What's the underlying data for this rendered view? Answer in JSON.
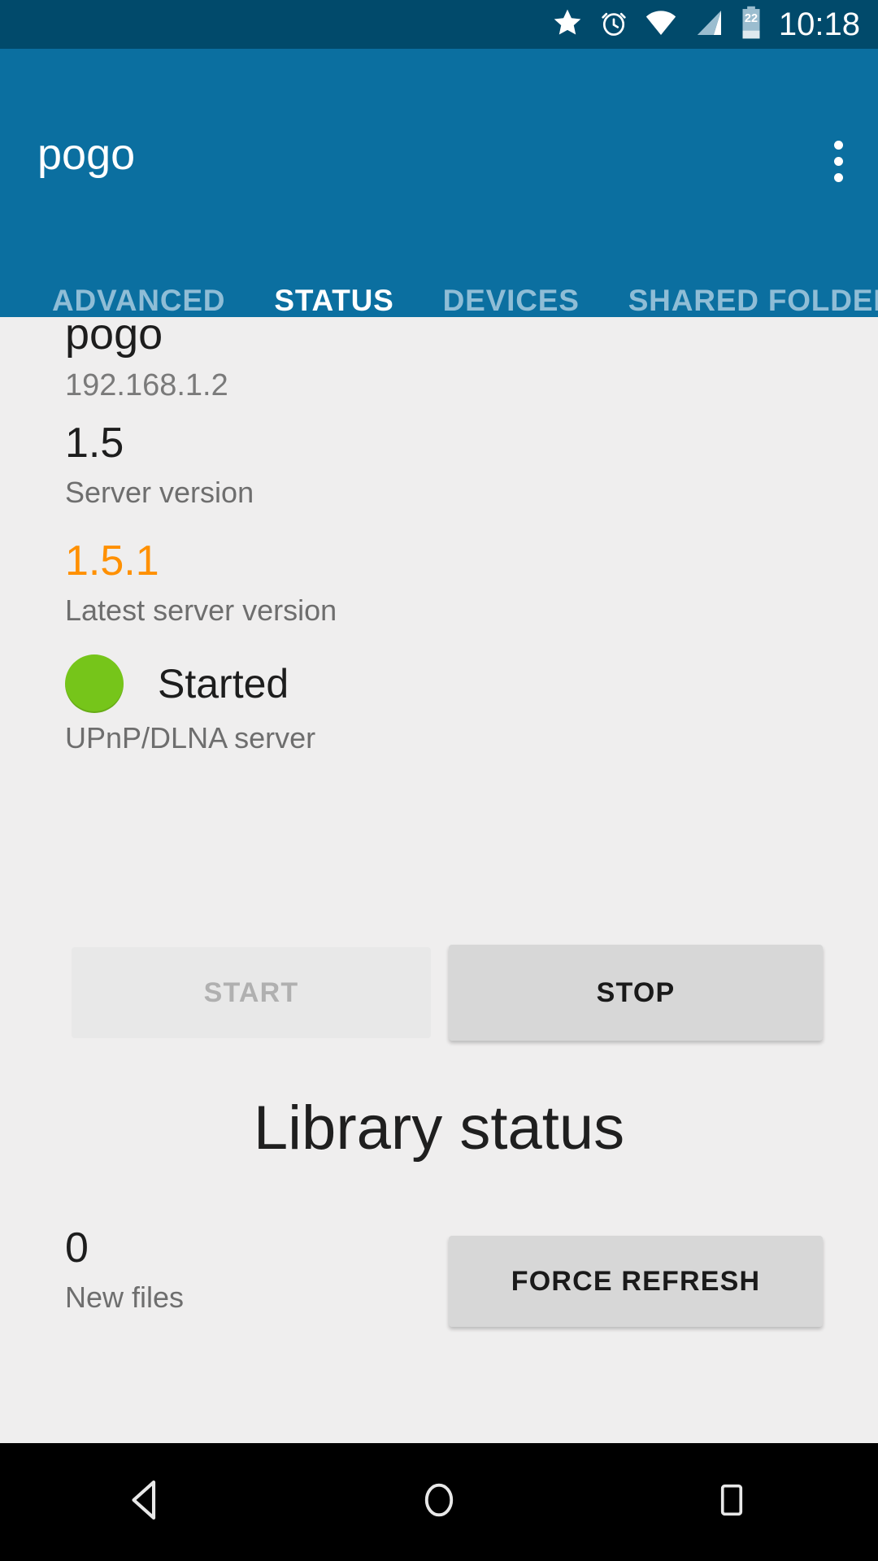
{
  "statusbar": {
    "time": "10:18",
    "battery_level": "22",
    "icons": [
      "star-icon",
      "alarm-icon",
      "wifi-icon",
      "signal-icon",
      "battery-icon"
    ]
  },
  "appbar": {
    "title": "pogo",
    "overflow_icon": "overflow-menu-icon",
    "accent_color": "#0B6FA0",
    "indicator_color": "#FBB63C"
  },
  "tabs": [
    {
      "label": "ADVANCED",
      "active": false
    },
    {
      "label": "STATUS",
      "active": true
    },
    {
      "label": "DEVICES",
      "active": false
    },
    {
      "label": "SHARED FOLDERS",
      "active": false
    }
  ],
  "status_page": {
    "host": {
      "name": "pogo",
      "address": "192.168.1.2"
    },
    "server_version": {
      "value": "1.5",
      "label": "Server version"
    },
    "latest_server_version": {
      "value": "1.5.1",
      "label": "Latest server version",
      "color": "#FF9000"
    },
    "server_state": {
      "value": "Started",
      "label": "UPnP/DLNA server",
      "dot_color": "#76C51A"
    },
    "start_button": "START",
    "stop_button": "STOP",
    "library": {
      "heading": "Library status",
      "new_files_count": "0",
      "new_files_label": "New files",
      "force_refresh_button": "FORCE REFRESH"
    }
  },
  "navbar": {
    "back": "back-icon",
    "home": "home-icon",
    "recents": "recents-icon"
  }
}
